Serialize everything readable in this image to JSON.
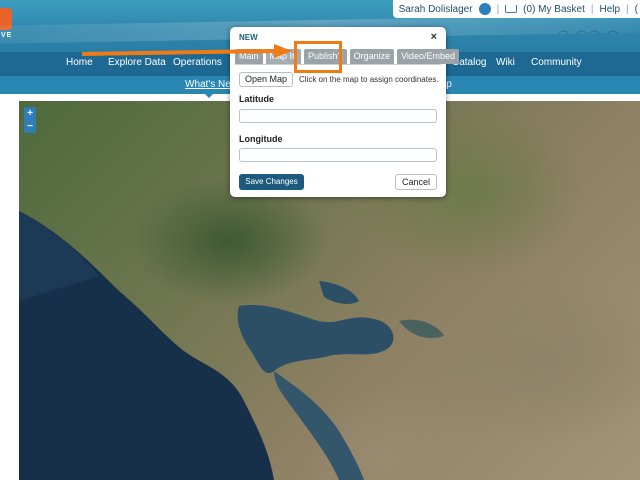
{
  "header": {
    "logo_text": "VE",
    "user_name": "Sarah Dolislager",
    "basket_label": "(0) My Basket",
    "help_label": "Help",
    "separator": "|",
    "last_char": "("
  },
  "nav": {
    "items": [
      "Home",
      "Explore Data",
      "Operations",
      "Catalog",
      "Wiki",
      "Community"
    ]
  },
  "subnav": {
    "items": [
      "What's New",
      "lp"
    ]
  },
  "map": {
    "zoom_in": "+",
    "zoom_out": "−"
  },
  "modal": {
    "title": "NEW",
    "close": "×",
    "tabs": [
      "Main",
      "Map It!",
      "Publish?",
      "Organize",
      "Video/Embed"
    ],
    "active_tab": "Map It!",
    "open_map_label": "Open Map",
    "hint": "Click on the map to assign coordinates.",
    "latitude_label": "Latitude",
    "latitude_value": "",
    "longitude_label": "Longitude",
    "longitude_value": "",
    "save_label": "Save Changes",
    "cancel_label": "Cancel"
  },
  "colors": {
    "annotation": "#f07a14",
    "primary_button": "#1e5a7e",
    "nav": "#1d6994"
  }
}
